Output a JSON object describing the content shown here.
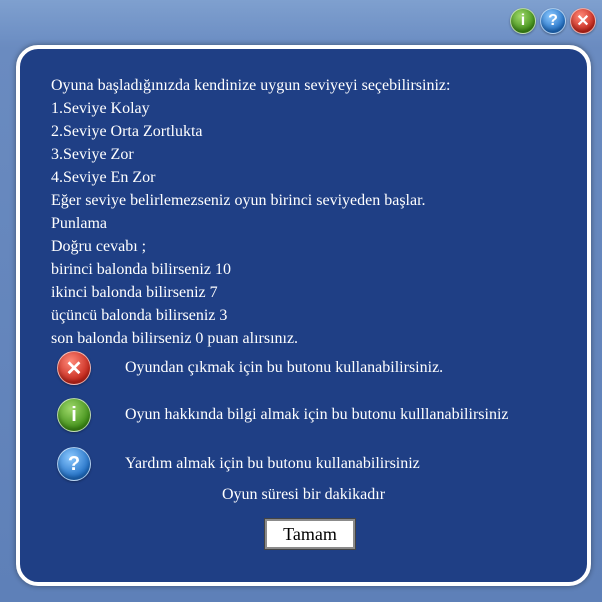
{
  "toolbar": {
    "info_glyph": "i",
    "help_glyph": "?",
    "close_glyph": "✕"
  },
  "instructions": {
    "lines": [
      "Oyuna başladığınızda kendinize uygun seviyeyi seçebilirsiniz:",
      "1.Seviye Kolay",
      "2.Seviye Orta Zortlukta",
      "3.Seviye Zor",
      "4.Seviye En Zor",
      "Eğer seviye belirlemezseniz oyun birinci seviyeden başlar.",
      "Punlama",
      "Doğru cevabı ;",
      "birinci balonda bilirseniz 10",
      "ikinci balonda bilirseniz 7",
      "üçüncü balonda bilirseniz 3",
      "son balonda bilirseniz 0 puan alırsınız."
    ]
  },
  "legend": {
    "close": {
      "glyph": "✕",
      "text": "Oyundan çıkmak için bu butonu kullanabilirsiniz."
    },
    "info": {
      "glyph": "i",
      "text": "Oyun hakkında bilgi almak için bu butonu kulllanabilirsiniz"
    },
    "help": {
      "glyph": "?",
      "text": "Yardım almak için bu butonu kullanabilirsiniz"
    }
  },
  "duration_text": "Oyun süresi bir dakikadır",
  "ok_label": "Tamam",
  "colors": {
    "panel_bg": "#1f3f85",
    "panel_border": "#ffffff",
    "info_icon": "#3f8f17",
    "help_icon": "#1f6ec4",
    "close_icon": "#c5261a"
  },
  "icons": {
    "info": "info-icon",
    "help": "help-icon",
    "close": "close-icon"
  }
}
